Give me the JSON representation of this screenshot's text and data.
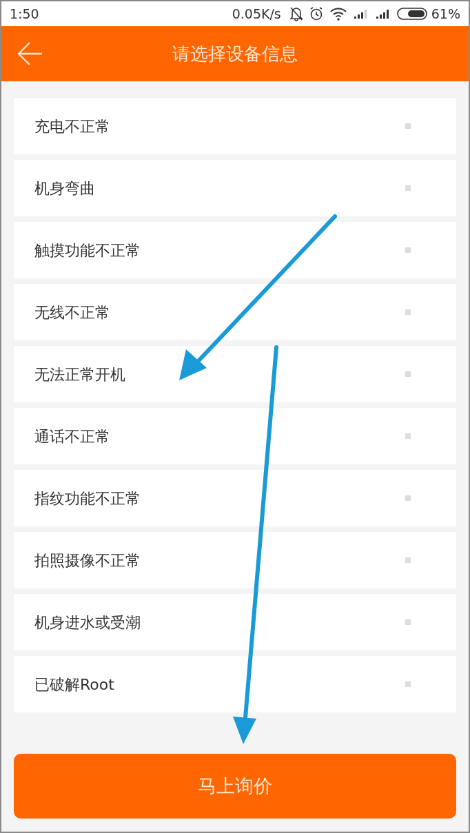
{
  "status_bar": {
    "time": "1:50",
    "speed": "0.05K/s",
    "battery": "61%"
  },
  "header": {
    "title": "请选择设备信息"
  },
  "options": [
    {
      "label": "充电不正常",
      "checked": false
    },
    {
      "label": "机身弯曲",
      "checked": false
    },
    {
      "label": "触摸功能不正常",
      "checked": false
    },
    {
      "label": "无线不正常",
      "checked": false
    },
    {
      "label": "无法正常开机",
      "checked": false
    },
    {
      "label": "通话不正常",
      "checked": false
    },
    {
      "label": "指纹功能不正常",
      "checked": false
    },
    {
      "label": "拍照摄像不正常",
      "checked": false
    },
    {
      "label": "机身进水或受潮",
      "checked": false
    },
    {
      "label": "已破解Root",
      "checked": false
    }
  ],
  "submit_button": "马上询价"
}
